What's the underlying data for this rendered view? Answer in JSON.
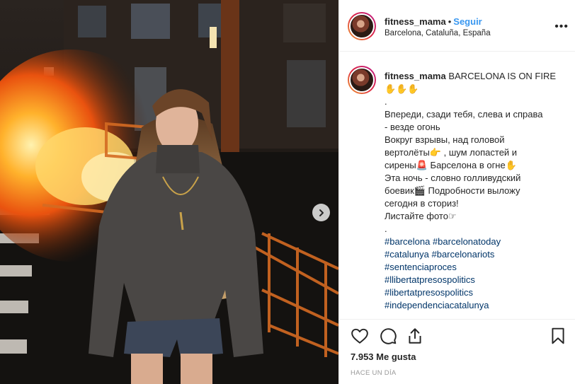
{
  "post": {
    "username": "fitness_mama",
    "separator": "•",
    "follow_label": "Seguir",
    "location": "Barcelona, Cataluña, España",
    "more_icon": "ellipsis-icon"
  },
  "caption": {
    "username": "fitness_mama",
    "first_line": "BARCELONA IS ON FIRE",
    "lines": [
      "✋✋✋",
      ".",
      "Впереди, сзади тебя, слева и справа",
      "- везде огонь",
      "Вокруг взрывы, над головой",
      "вертолёты👉 , шум лопастей и",
      "сирены🚨 Барселона в огне✋",
      "Эта ночь - словно голливудский",
      "боевик🎬 Подробности выложу",
      "сегодня в сториз!",
      "Листайте фото☞",
      "."
    ],
    "hashtag_lines": [
      "#barcelona #barcelonatoday",
      "#catalunya #barcelonariots",
      "#sentenciaproces",
      "#llibertatpresospolitics",
      "#libertatpresospolitics",
      "#independenciacatalunya"
    ]
  },
  "actions": {
    "likes": "7.953 Me gusta",
    "time": "HACE UN DÍA",
    "icons": [
      "heart-icon",
      "comment-icon",
      "share-icon",
      "bookmark-icon"
    ]
  },
  "photo": {
    "next_icon": "chevron-right-icon"
  },
  "colors": {
    "link": "#3897f0",
    "hashtag": "#003569",
    "text": "#262626",
    "muted": "#999999",
    "border": "#efefef"
  }
}
